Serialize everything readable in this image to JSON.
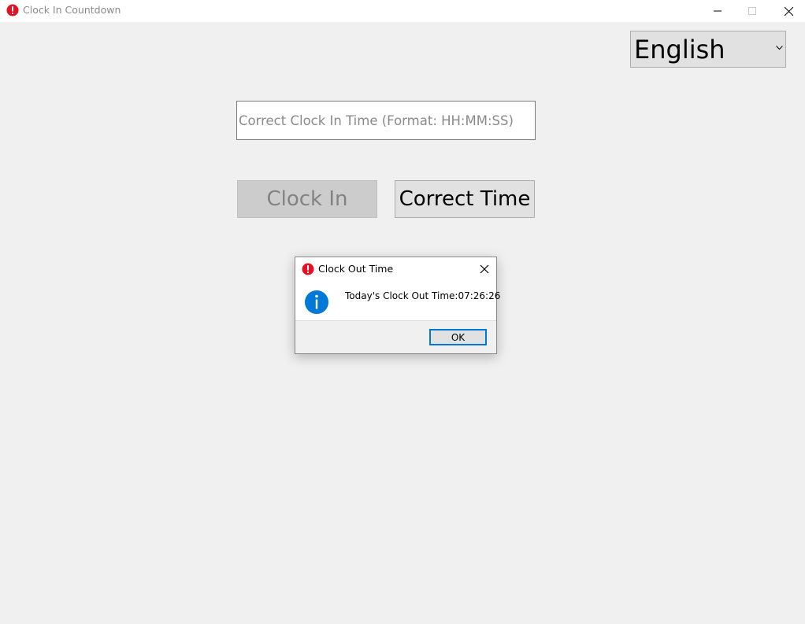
{
  "window": {
    "title": "Clock In Countdown",
    "app_icon": "error-icon"
  },
  "language_select": {
    "selected": "English"
  },
  "time_input": {
    "value": "",
    "placeholder": "Correct Clock In Time (Format: HH:MM:SS)"
  },
  "buttons": {
    "clock_in_label": "Clock In",
    "clock_in_enabled": false,
    "correct_time_label": "Correct Time"
  },
  "dialog": {
    "title": "Clock Out Time",
    "title_icon": "error-icon",
    "body_icon": "info-icon",
    "message": "Today's Clock Out Time:07:26:26",
    "ok_label": "OK"
  },
  "colors": {
    "error_red": "#e81123",
    "info_blue": "#0078d7",
    "focus_blue": "#0078d7"
  }
}
